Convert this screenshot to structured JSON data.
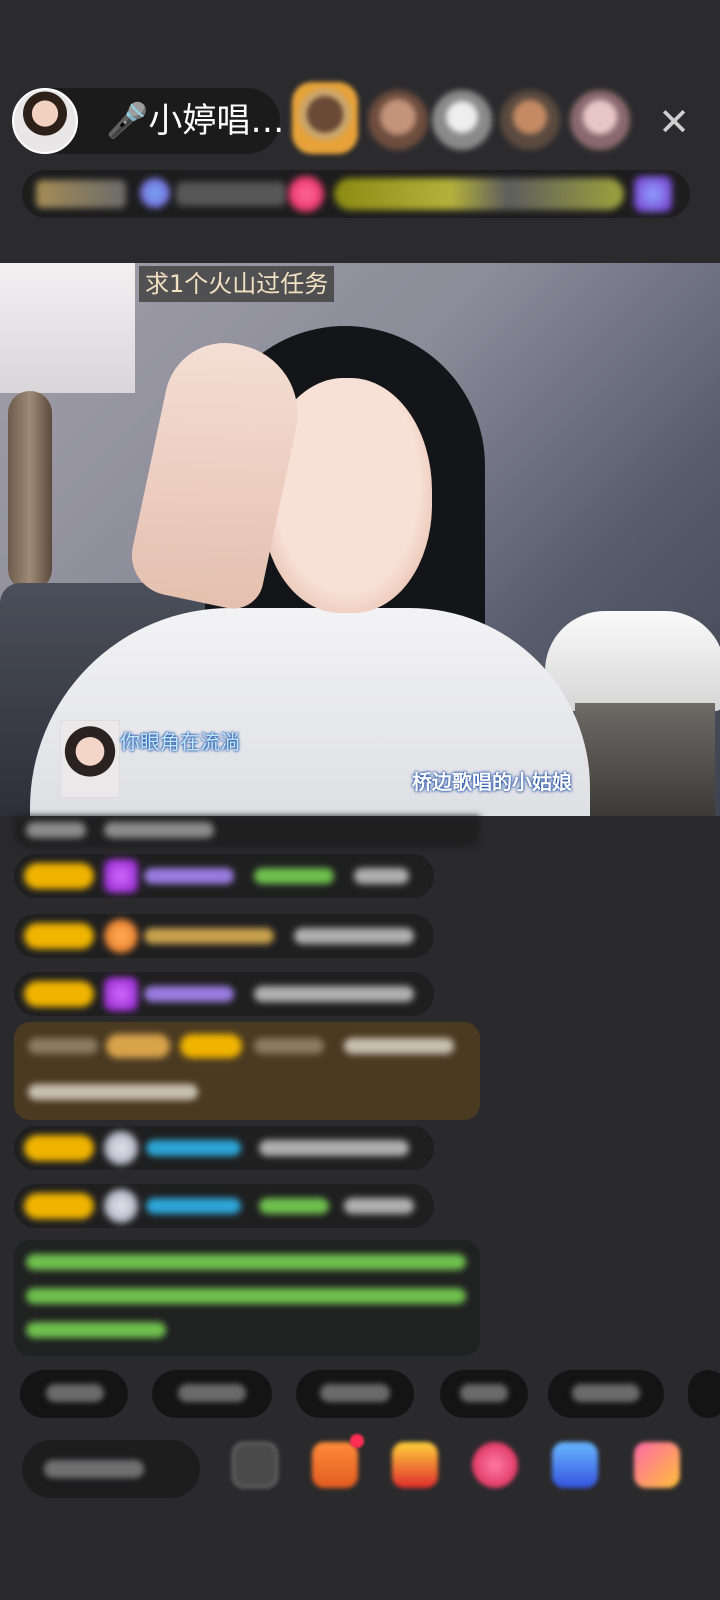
{
  "header": {
    "host_name": "🎤小婷唱…",
    "close_icon": "✕",
    "viewers": [
      "viewer-1",
      "viewer-2",
      "viewer-3",
      "viewer-4",
      "viewer-5"
    ]
  },
  "video": {
    "overlay_title": "求1个火山过任务",
    "lyric": "你眼角在流淌",
    "song_title": "桥边歌唱的小姑娘"
  },
  "colors": {
    "background": "#2a2a2c",
    "overlay_text": "#f2e1c1",
    "lyric_text": "#bfe9ff",
    "badge_gold": "#f0b400",
    "gem_purple": "#b02de8",
    "chat_green": "#6fc04e",
    "chat_blue": "#2ca6d8"
  },
  "icons": {
    "close": "close-icon",
    "gift": "gift-icon",
    "chat": "chat-icon",
    "game": "game-icon",
    "more": "more-icon"
  }
}
